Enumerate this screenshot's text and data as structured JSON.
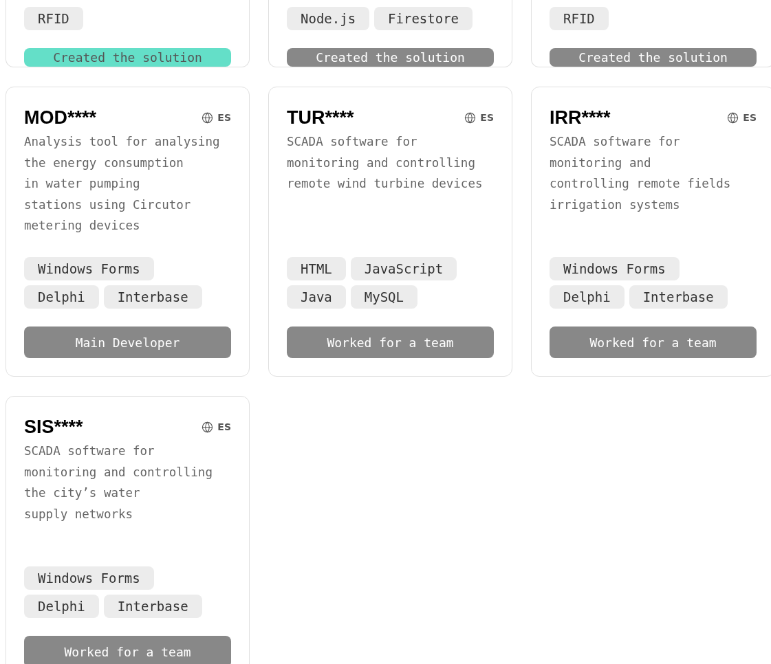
{
  "projects": [
    {
      "tags": [
        "RFID"
      ],
      "role": {
        "label": "Created the solution",
        "highlighted": true
      }
    },
    {
      "tags": [
        "Node.js",
        "Firestore"
      ],
      "role": {
        "label": "Created the solution",
        "highlighted": false
      }
    },
    {
      "tags": [
        "RFID"
      ],
      "role": {
        "label": "Created the solution",
        "highlighted": false
      }
    },
    {
      "title": "MOD****",
      "language": "ES",
      "description": "Analysis tool for analysing\nthe energy consumption\nin water pumping\nstations using Circutor\nmetering devices",
      "tags": [
        "Windows Forms",
        "Delphi",
        "Interbase"
      ],
      "role": {
        "label": "Main Developer",
        "highlighted": false
      }
    },
    {
      "title": "TUR****",
      "language": "ES",
      "description": "SCADA software for\nmonitoring and controlling\nremote wind turbine devices",
      "tags": [
        "HTML",
        "JavaScript",
        "Java",
        "MySQL"
      ],
      "role": {
        "label": "Worked for a team",
        "highlighted": false
      }
    },
    {
      "title": "IRR****",
      "language": "ES",
      "description": "SCADA software for\nmonitoring and\ncontrolling remote fields\nirrigation systems",
      "tags": [
        "Windows Forms",
        "Delphi",
        "Interbase"
      ],
      "role": {
        "label": "Worked for a team",
        "highlighted": false
      }
    },
    {
      "title": "SIS****",
      "language": "ES",
      "description": "SCADA software for\nmonitoring and controlling\nthe city’s water\nsupply networks",
      "tags": [
        "Windows Forms",
        "Delphi",
        "Interbase"
      ],
      "role": {
        "label": "Worked for a team",
        "highlighted": false
      }
    }
  ]
}
